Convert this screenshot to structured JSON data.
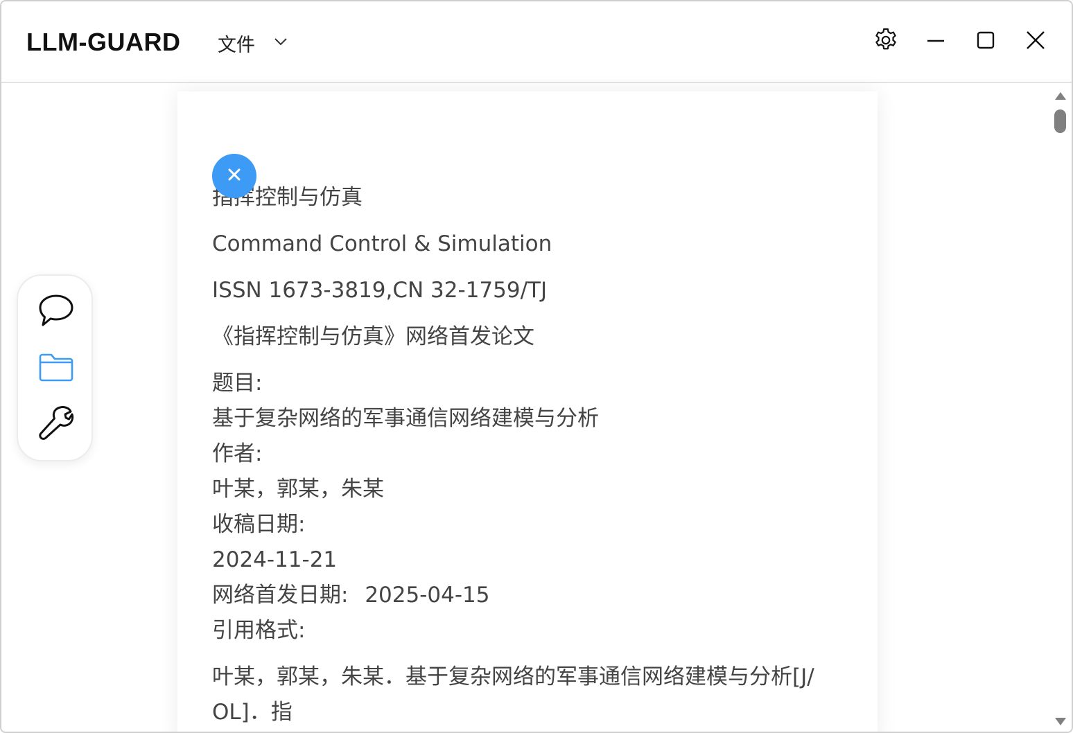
{
  "app": {
    "title": "LLM-GUARD",
    "menu_file_label": "文件"
  },
  "titlebar_icons": [
    "gear-icon",
    "minimize-icon",
    "maximize-icon",
    "close-icon"
  ],
  "sidebar": {
    "items": [
      {
        "icon": "chat-bubble-icon",
        "active": false
      },
      {
        "icon": "folder-icon",
        "active": true
      },
      {
        "icon": "wrench-icon",
        "active": false
      }
    ]
  },
  "colors": {
    "accent": "#3d9af5",
    "folder_active": "#3d9af5",
    "text": "#444444"
  },
  "document": {
    "journal_cn": "指挥控制与仿真",
    "journal_en": "Command Control & Simulation",
    "issn": "ISSN 1673-3819,CN 32-1759/TJ",
    "first_release": "《指挥控制与仿真》网络首发论文",
    "title_label": "题目:",
    "title_value": "基于复杂网络的军事通信网络建模与分析",
    "author_label": "作者:",
    "author_value": "叶某，郭某，朱某",
    "received_label": "收稿日期:",
    "received_value": "2024-11-21",
    "online_label": "网络首发日期:",
    "online_value": "2025-04-15",
    "citation_label": "引用格式:",
    "citation_line1": "叶某，郭某，朱某．基于复杂网络的军事通信网络建模与分析[J/",
    "citation_line2": "OL]．指"
  }
}
